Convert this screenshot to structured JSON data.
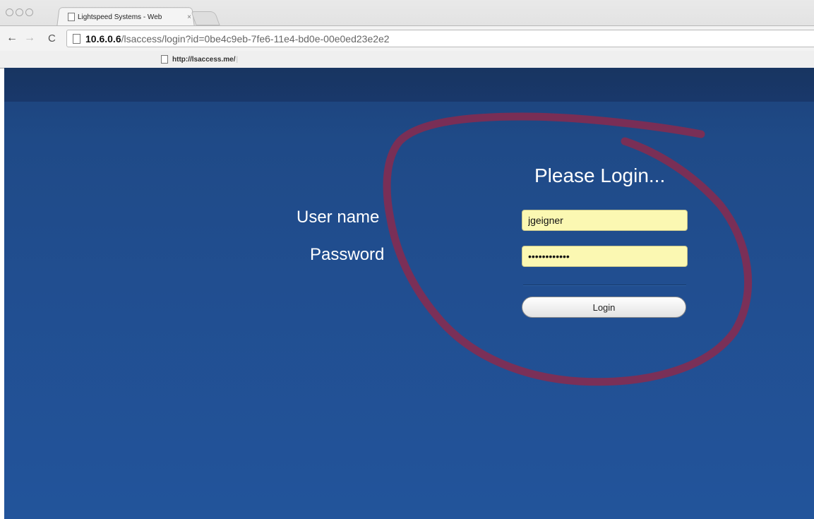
{
  "browser": {
    "tab_title": "Lightspeed Systems - Web",
    "tab_close": "×",
    "url_host": "10.6.0.6",
    "url_rest": "/lsaccess/login?id=0be4c9eb-7fe6-11e4-bd0e-00e0ed23e2e2",
    "bookmark_label": "http://lsaccess.me/",
    "bookmark_sep": "|",
    "back_icon": "←",
    "forward_icon": "→",
    "reload_icon": "C"
  },
  "login": {
    "heading": "Please Login...",
    "username_label": "User name",
    "password_label": "Password",
    "username_value": "jgeigner",
    "password_value": "••••••••••••",
    "button_label": "Login"
  },
  "annotation": {
    "color": "#8a2a4e"
  }
}
